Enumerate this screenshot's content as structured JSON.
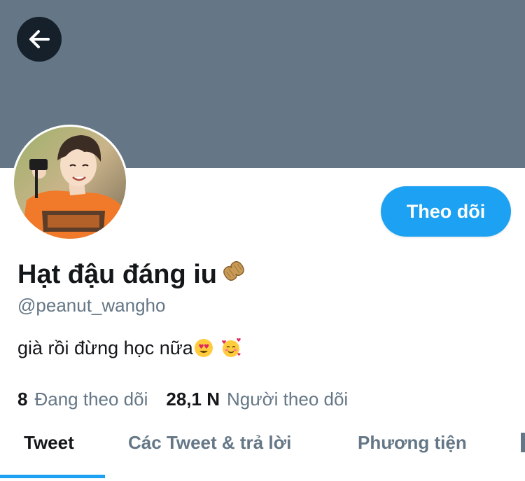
{
  "header": {
    "back_icon": "arrow-left-icon"
  },
  "profile": {
    "display_name": "Hạt đậu đáng iu",
    "handle": "@peanut_wangho",
    "bio": "già rồi đừng học nữa",
    "follow_label": "Theo dõi",
    "name_emoji": "peanut-emoji",
    "bio_emojis": [
      "heart-eyes-emoji",
      "smiling-hearts-emoji"
    ]
  },
  "stats": {
    "following_count": "8",
    "following_label": "Đang theo dõi",
    "followers_count": "28,1 N",
    "followers_label": "Người theo dõi"
  },
  "tabs": [
    {
      "label": "Tweet",
      "active": true
    },
    {
      "label": "Các Tweet & trả lời",
      "active": false
    },
    {
      "label": "Phương tiện",
      "active": false
    }
  ],
  "colors": {
    "banner": "#657786",
    "accent": "#1da1f2",
    "text_primary": "#14171a",
    "text_secondary": "#657786"
  }
}
